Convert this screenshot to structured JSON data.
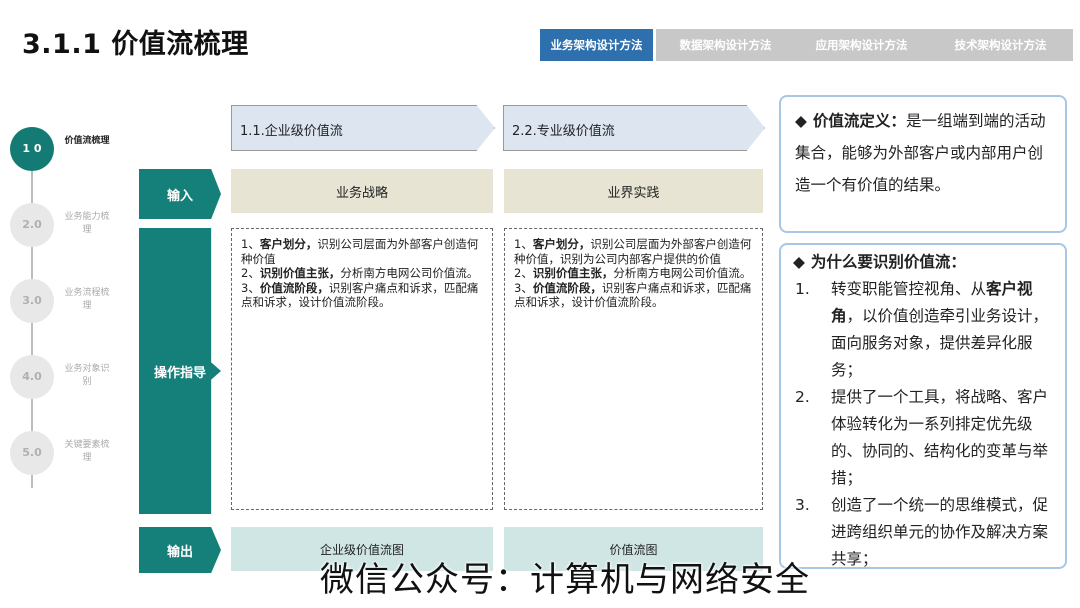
{
  "page": {
    "title": "3.1.1 价值流梳理"
  },
  "tabs": [
    {
      "label": "业务架构设计方法",
      "active": true
    },
    {
      "label": "数据架构设计方法",
      "active": false
    },
    {
      "label": "应用架构设计方法",
      "active": false
    },
    {
      "label": "技术架构设计方法",
      "active": false
    }
  ],
  "steps": [
    {
      "num": "1 0",
      "label": "价值流梳理",
      "active": true
    },
    {
      "num": "2.0",
      "label": "业务能力梳理",
      "active": false
    },
    {
      "num": "3.0",
      "label": "业务流程梳理",
      "active": false
    },
    {
      "num": "4.0",
      "label": "业务对象识别",
      "active": false
    },
    {
      "num": "5.0",
      "label": "关键要素梳理",
      "active": false
    }
  ],
  "rows": {
    "input": "输入",
    "guide": "操作指导",
    "output": "输出"
  },
  "columns": [
    {
      "header": "1.1.企业级价值流",
      "input": "业务战略",
      "guide": {
        "l1_bold": "客户划分，",
        "l1_text": "识别公司层面为外部客户创造何种价值",
        "l2_bold": "识别价值主张，",
        "l2_text": "分析南方电网公司价值流。",
        "l3_bold": "价值流阶段，",
        "l3_text": "识别客户痛点和诉求，匹配痛点和诉求，设计价值流阶段。"
      },
      "output": "企业级价值流图"
    },
    {
      "header": "2.2.专业级价值流",
      "input": "业界实践",
      "guide": {
        "l1_bold": "客户划分，",
        "l1_text": "识别公司层面为外部客户创造何种价值，识别为公司内部客户提供的价值",
        "l2_bold": "识别价值主张，",
        "l2_text": "分析南方电网公司价值流。",
        "l3_bold": "价值流阶段，",
        "l3_text": "识别客户痛点和诉求，匹配痛点和诉求，设计价值流阶段。"
      },
      "output": "价值流图"
    }
  ],
  "definition": {
    "bullet": "◆",
    "term": "价值流定义：",
    "text": "是一组端到端的活动集合，能够为外部客户或内部用户创造一个有价值的结果。"
  },
  "why": {
    "bullet": "◆",
    "heading": "为什么要识别价值流：",
    "items": [
      {
        "num": "1.",
        "pre": "转变职能管控视角、从",
        "bold": "客户视角",
        "post": "，以价值创造牵引业务设计，面向服务对象，提供差异化服务；"
      },
      {
        "num": "2.",
        "text": "提供了一个工具，将战略、客户体验转化为一系列排定优先级的、协同的、结构化的变革与举措；"
      },
      {
        "num": "3.",
        "text": "创造了一个统一的思维模式，促进跨组织单元的协作及解决方案共享；"
      }
    ]
  },
  "watermark": "微信公众号：计算机与网络安全"
}
